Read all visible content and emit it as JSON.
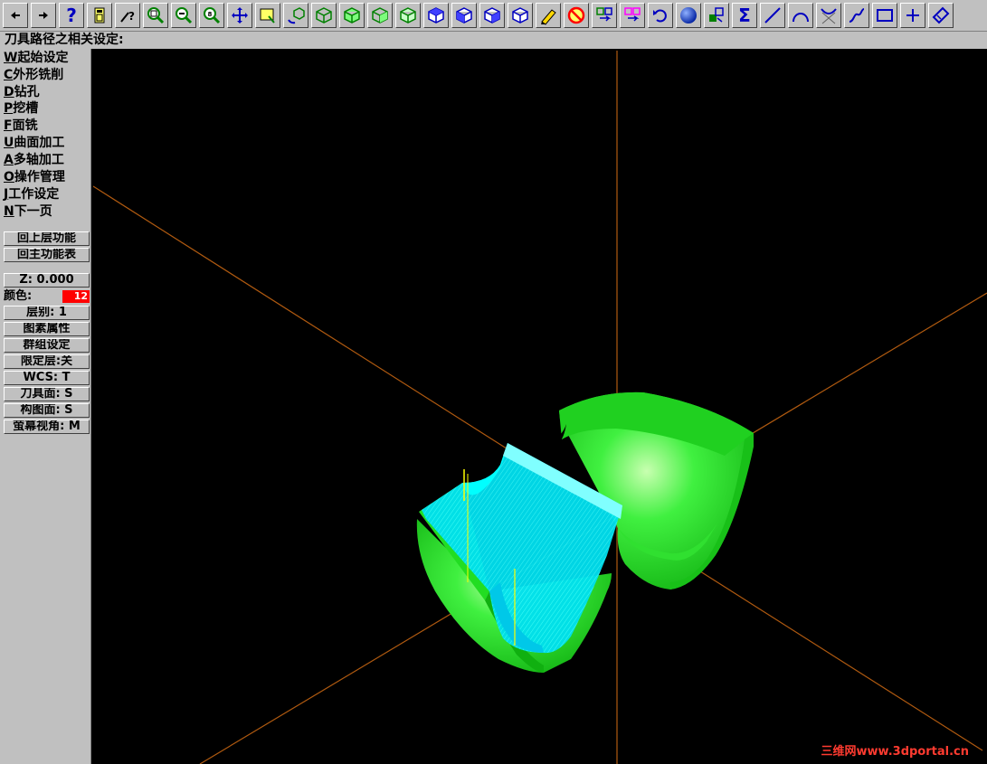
{
  "prompt": "刀具路径之相关设定:",
  "toolbar": {
    "help": "?",
    "sum": "Σ"
  },
  "menu": {
    "items": [
      {
        "key": "W",
        "label": "起始设定"
      },
      {
        "key": "C",
        "label": "外形铣削"
      },
      {
        "key": "D",
        "label": "钻孔"
      },
      {
        "key": "P",
        "label": "挖槽"
      },
      {
        "key": "F",
        "label": "面铣"
      },
      {
        "key": "U",
        "label": "曲面加工"
      },
      {
        "key": "A",
        "label": "多轴加工"
      },
      {
        "key": "O",
        "label": "操作管理"
      },
      {
        "key": "J",
        "label": "工作设定"
      },
      {
        "key": "N",
        "label": "下一页"
      }
    ],
    "back_up": "回上层功能",
    "back_main": "回主功能表"
  },
  "status": {
    "z": "Z:  0.000",
    "color_label": "颜色:",
    "color_value": "12",
    "color_hex": "#ff0000",
    "level": "层别: 1",
    "attributes": "图素属性",
    "group": "群组设定",
    "mask": "限定层:关",
    "wcs": "WCS:  T",
    "tplane": "刀具面: S",
    "cplane": "构图面: S",
    "gview": "萤幕视角: M"
  },
  "colors": {
    "part": "#22dd22",
    "toolpath": "#00ffff",
    "axes": "#b05a10",
    "tool": "#ffff00"
  },
  "watermark": "三维网www.3dportal.cn"
}
